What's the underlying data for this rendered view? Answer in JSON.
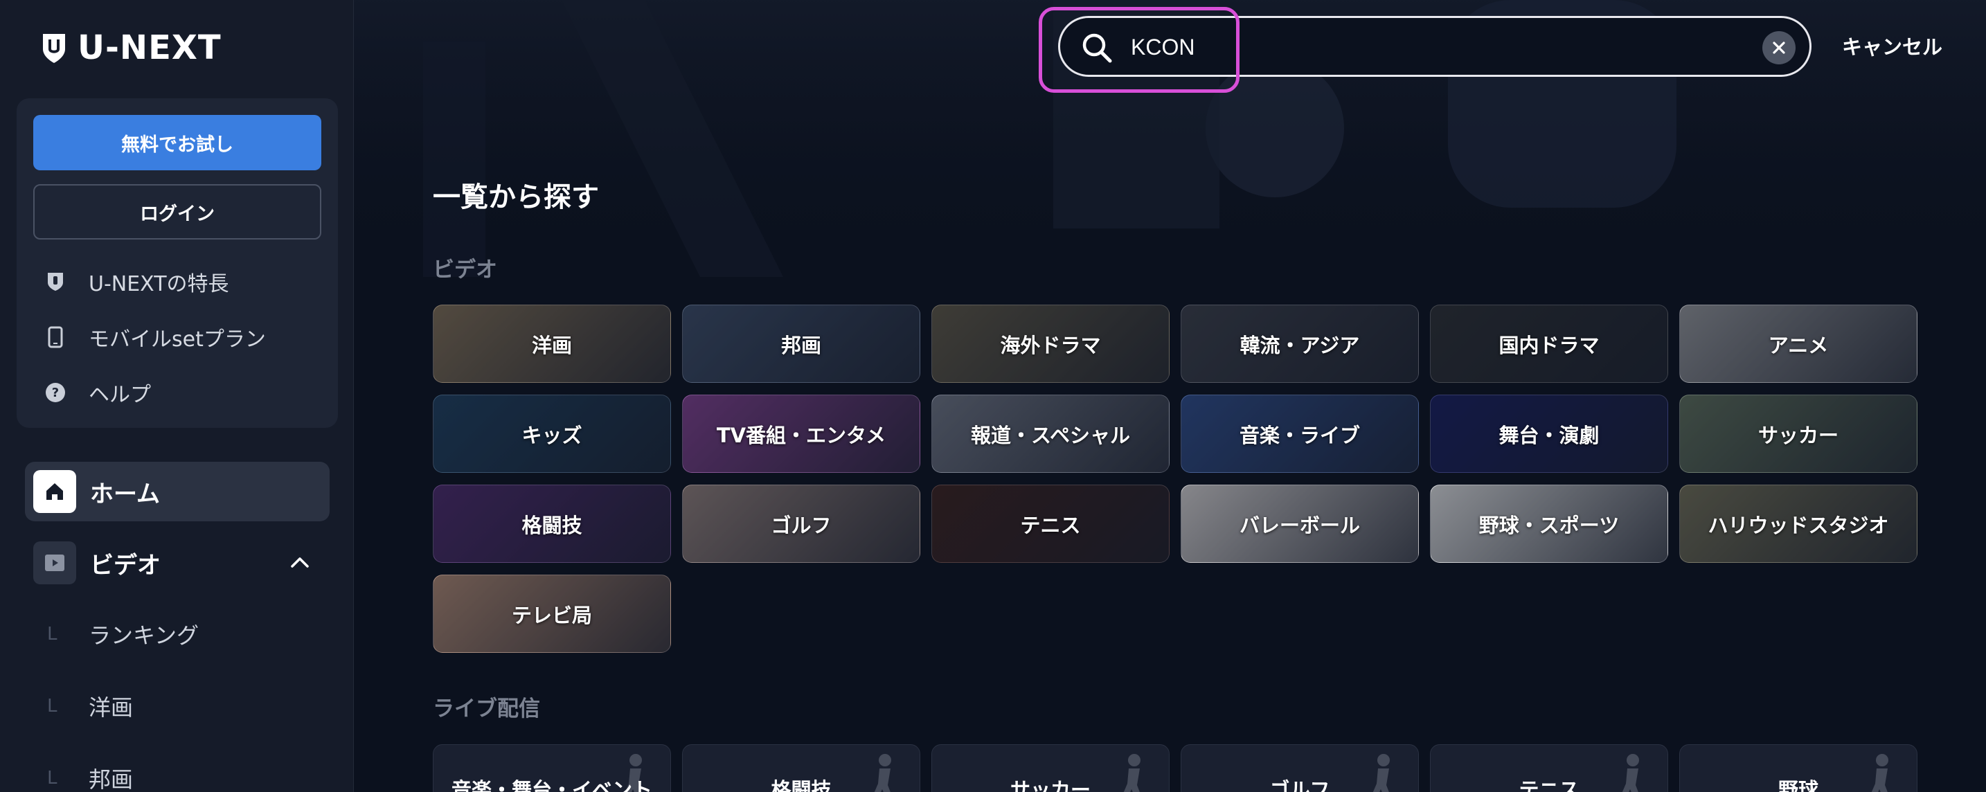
{
  "brand": {
    "name": "U-NEXT"
  },
  "sidebar": {
    "trial_button": "無料でお試し",
    "login_button": "ログイン",
    "info_links": [
      {
        "label": "U-NEXTの特長",
        "icon": "shield-icon"
      },
      {
        "label": "モバイルsetプラン",
        "icon": "mobile-icon"
      },
      {
        "label": "ヘルプ",
        "icon": "help-icon"
      }
    ],
    "nav": {
      "home": "ホーム",
      "video": "ビデオ",
      "video_sub": [
        "ランキング",
        "洋画",
        "邦画"
      ]
    }
  },
  "search": {
    "value": "KCON",
    "cancel": "キャンセル"
  },
  "main": {
    "title": "一覧から探す",
    "video_section": "ビデオ",
    "video_categories": [
      {
        "label": "洋画",
        "color": "#7a6a55"
      },
      {
        "label": "邦画",
        "color": "#3b4a66"
      },
      {
        "label": "海外ドラマ",
        "color": "#5b5547"
      },
      {
        "label": "韓流・アジア",
        "color": "#3a3e4a"
      },
      {
        "label": "国内ドラマ",
        "color": "#2c2f36"
      },
      {
        "label": "アニメ",
        "color": "#8d8f95"
      },
      {
        "label": "キッズ",
        "color": "#1f3e5e"
      },
      {
        "label": "TV番組・エンタメ",
        "color": "#7a3f8a"
      },
      {
        "label": "報道・スペシャル",
        "color": "#6a7080"
      },
      {
        "label": "音楽・ライブ",
        "color": "#2e4a86"
      },
      {
        "label": "舞台・演劇",
        "color": "#1a1f5e"
      },
      {
        "label": "サッカー",
        "color": "#5a6a5a"
      },
      {
        "label": "格闘技",
        "color": "#4a2a6a"
      },
      {
        "label": "ゴルフ",
        "color": "#8a7a78"
      },
      {
        "label": "テニス",
        "color": "#3a2222"
      },
      {
        "label": "バレーボール",
        "color": "#c9c6c8"
      },
      {
        "label": "野球・スポーツ",
        "color": "#d2d3d6"
      },
      {
        "label": "ハリウッドスタジオ",
        "color": "#6c6a56"
      },
      {
        "label": "テレビ局",
        "color": "#a58270"
      }
    ],
    "live_section": "ライブ配信",
    "live_categories": [
      "音楽・舞台・イベント",
      "格闘技",
      "サッカー",
      "ゴルフ",
      "テニス",
      "野球"
    ]
  }
}
